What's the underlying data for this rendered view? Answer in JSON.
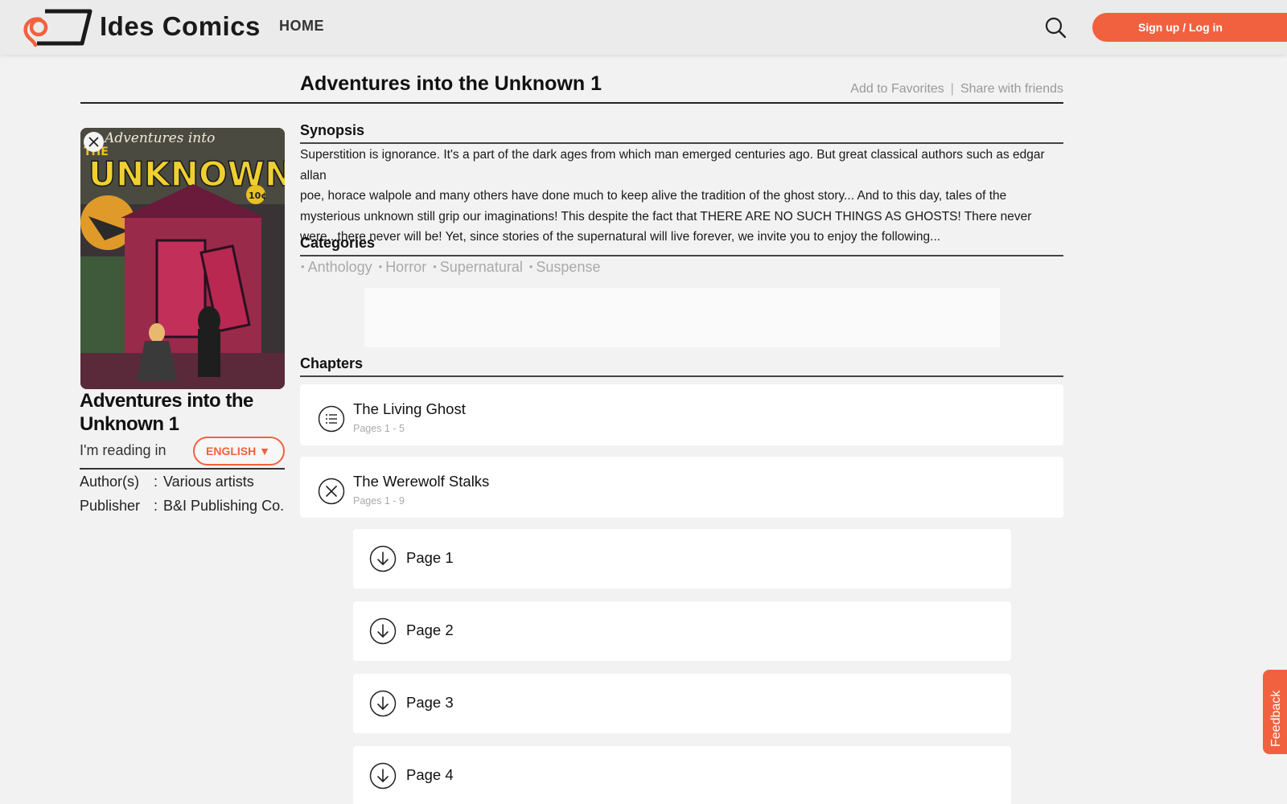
{
  "header": {
    "brand": "Ides Comics",
    "nav_home": "HOME",
    "signup_label": "Sign up / Log in",
    "accent_color": "#f2613f"
  },
  "comic": {
    "title": "Adventures into the Unknown 1",
    "actions": {
      "favorites": "Add to Favorites",
      "separator": "|",
      "share": "Share with friends"
    },
    "cover_alt": "Adventures into THE UNKNOWN! 10¢",
    "reading_label": "I'm reading in",
    "language": "ENGLISH ▼",
    "meta": [
      {
        "key": "Author(s)",
        "colon": ":",
        "value": "Various artists"
      },
      {
        "key": "Publisher",
        "colon": ":",
        "value": "B&I Publishing Co."
      }
    ]
  },
  "synopsis": {
    "heading": "Synopsis",
    "lines": [
      "Superstition is ignorance. It's a part of the dark ages from which man emerged centuries ago. But great classical authors such as edgar allan",
      "poe, horace walpole and many others have done much to keep alive the tradition of the ghost story... And to this day, tales of the",
      "mysterious unknown still grip our imaginations! This despite the fact that THERE ARE NO SUCH THINGS AS GHOSTS! There never",
      "were...there never will be! Yet, since stories of the supernatural will live forever, we invite you to enjoy the following..."
    ]
  },
  "categories": {
    "heading": "Categories",
    "bullet": "•",
    "items": [
      "Anthology",
      "Horror",
      "Supernatural",
      "Suspense"
    ]
  },
  "chapters": {
    "heading": "Chapters",
    "items": [
      {
        "title": "The Living Ghost",
        "pages": "Pages 1 - 5",
        "icon": "list-icon"
      },
      {
        "title": "The Werewolf Stalks",
        "pages": "Pages 1 - 9",
        "icon": "close-circle-icon"
      }
    ],
    "pages": [
      "Page 1",
      "Page 2",
      "Page 3",
      "Page 4"
    ]
  },
  "feedback_label": "Feedback"
}
